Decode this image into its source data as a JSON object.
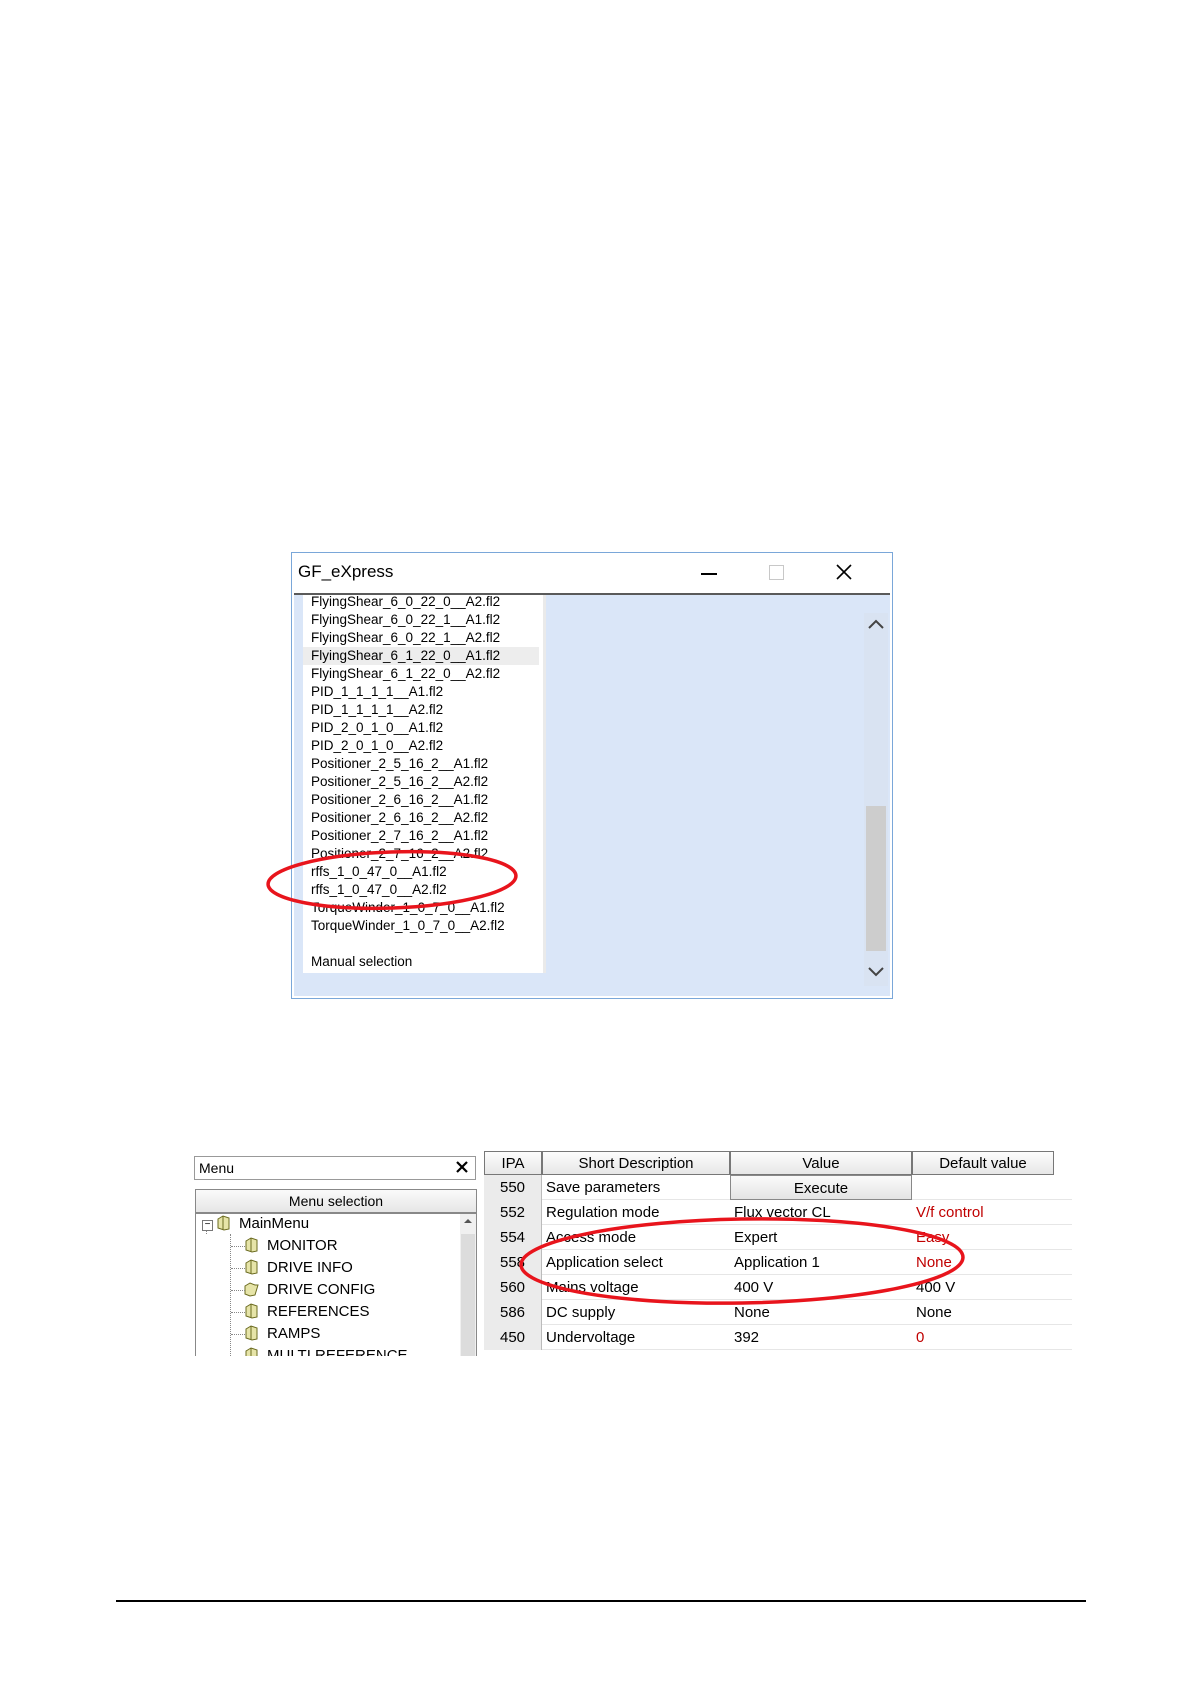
{
  "window": {
    "title": "GF_eXpress",
    "files": [
      "FlyingShear_6_0_22_0__A2.fl2",
      "FlyingShear_6_0_22_1__A1.fl2",
      "FlyingShear_6_0_22_1__A2.fl2",
      "FlyingShear_6_1_22_0__A1.fl2",
      "FlyingShear_6_1_22_0__A2.fl2",
      "PID_1_1_1_1__A1.fl2",
      "PID_1_1_1_1__A2.fl2",
      "PID_2_0_1_0__A1.fl2",
      "PID_2_0_1_0__A2.fl2",
      "Positioner_2_5_16_2__A1.fl2",
      "Positioner_2_5_16_2__A2.fl2",
      "Positioner_2_6_16_2__A1.fl2",
      "Positioner_2_6_16_2__A2.fl2",
      "Positioner_2_7_16_2__A1.fl2",
      "Positioner_2_7_16_2__A2.fl2",
      "rffs_1_0_47_0__A1.fl2",
      "rffs_1_0_47_0__A2.fl2",
      "TorqueWinder_1_0_7_0__A1.fl2",
      "TorqueWinder_1_0_7_0__A2.fl2",
      "",
      "Manual selection"
    ],
    "selected_file": "FlyingShear_6_1_22_0__A1.fl2"
  },
  "menu_panel": {
    "header": "Menu",
    "selection_button": "Menu selection",
    "tree": {
      "root": "MainMenu",
      "items": [
        "MONITOR",
        "DRIVE INFO",
        "DRIVE CONFIG",
        "REFERENCES",
        "RAMPS",
        "MULTI REFERENCE"
      ]
    }
  },
  "param_table": {
    "columns": [
      "IPA",
      "Short Description",
      "Value",
      "Default value"
    ],
    "rows": [
      {
        "ipa": "550",
        "desc": "Save parameters",
        "value": "Execute",
        "default": ""
      },
      {
        "ipa": "552",
        "desc": "Regulation mode",
        "value": "Flux vector CL",
        "default": "V/f control"
      },
      {
        "ipa": "554",
        "desc": "Access mode",
        "value": "Expert",
        "default": "Easy"
      },
      {
        "ipa": "558",
        "desc": "Application select",
        "value": "Application 1",
        "default": "None"
      },
      {
        "ipa": "560",
        "desc": "Mains voltage",
        "value": "400 V",
        "default": "400 V"
      },
      {
        "ipa": "586",
        "desc": "DC supply",
        "value": "None",
        "default": "None"
      },
      {
        "ipa": "450",
        "desc": "Undervoltage",
        "value": "392",
        "default": "0"
      }
    ]
  },
  "colors": {
    "highlight_ellipse": "#e8141c",
    "changed_default_text": "#c00000",
    "client_background": "#dae6f8"
  }
}
